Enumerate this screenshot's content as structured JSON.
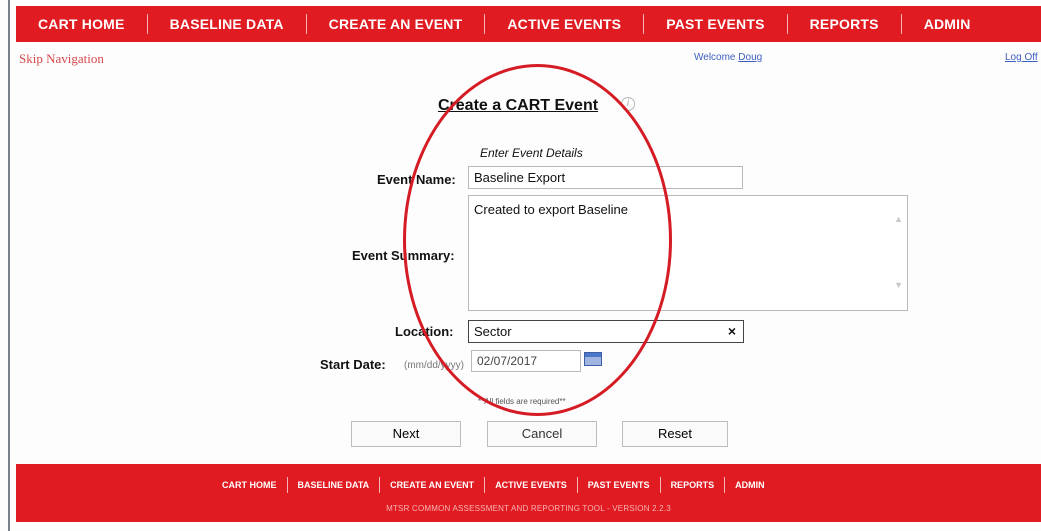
{
  "topnav": {
    "items": [
      "CART HOME",
      "BASELINE DATA",
      "CREATE AN EVENT",
      "ACTIVE EVENTS",
      "PAST EVENTS",
      "REPORTS",
      "ADMIN"
    ]
  },
  "header": {
    "skip_nav": "Skip Navigation",
    "welcome_prefix": "Welcome",
    "user": "Doug",
    "logoff": "Log Off"
  },
  "form": {
    "title": "Create a CART Event",
    "subhead": "Enter Event Details",
    "name_label": "Event Name:",
    "name_value": "Baseline Export",
    "summary_label": "Event Summary:",
    "summary_value": "Created to export Baseline",
    "location_label": "Location:",
    "location_value": "Sector",
    "start_label": "Start Date:",
    "date_hint": "(mm/dd/yyyy)",
    "start_value": "02/07/2017",
    "required_note": "**All fields are required**",
    "buttons": {
      "next": "Next",
      "cancel": "Cancel",
      "reset": "Reset"
    }
  },
  "footer": {
    "items": [
      "CART HOME",
      "BASELINE DATA",
      "CREATE AN EVENT",
      "ACTIVE EVENTS",
      "PAST EVENTS",
      "REPORTS",
      "ADMIN"
    ],
    "version_text": "MTSR COMMON ASSESSMENT AND REPORTING TOOL - VERSION 2.2.3"
  },
  "colors": {
    "brand_red": "#e01b21",
    "link_blue": "#3d5fbf",
    "annotation_red": "#d51b24"
  },
  "icons": {
    "info": "info-icon",
    "calendar": "calendar-icon",
    "clear": "clear-x-icon"
  }
}
